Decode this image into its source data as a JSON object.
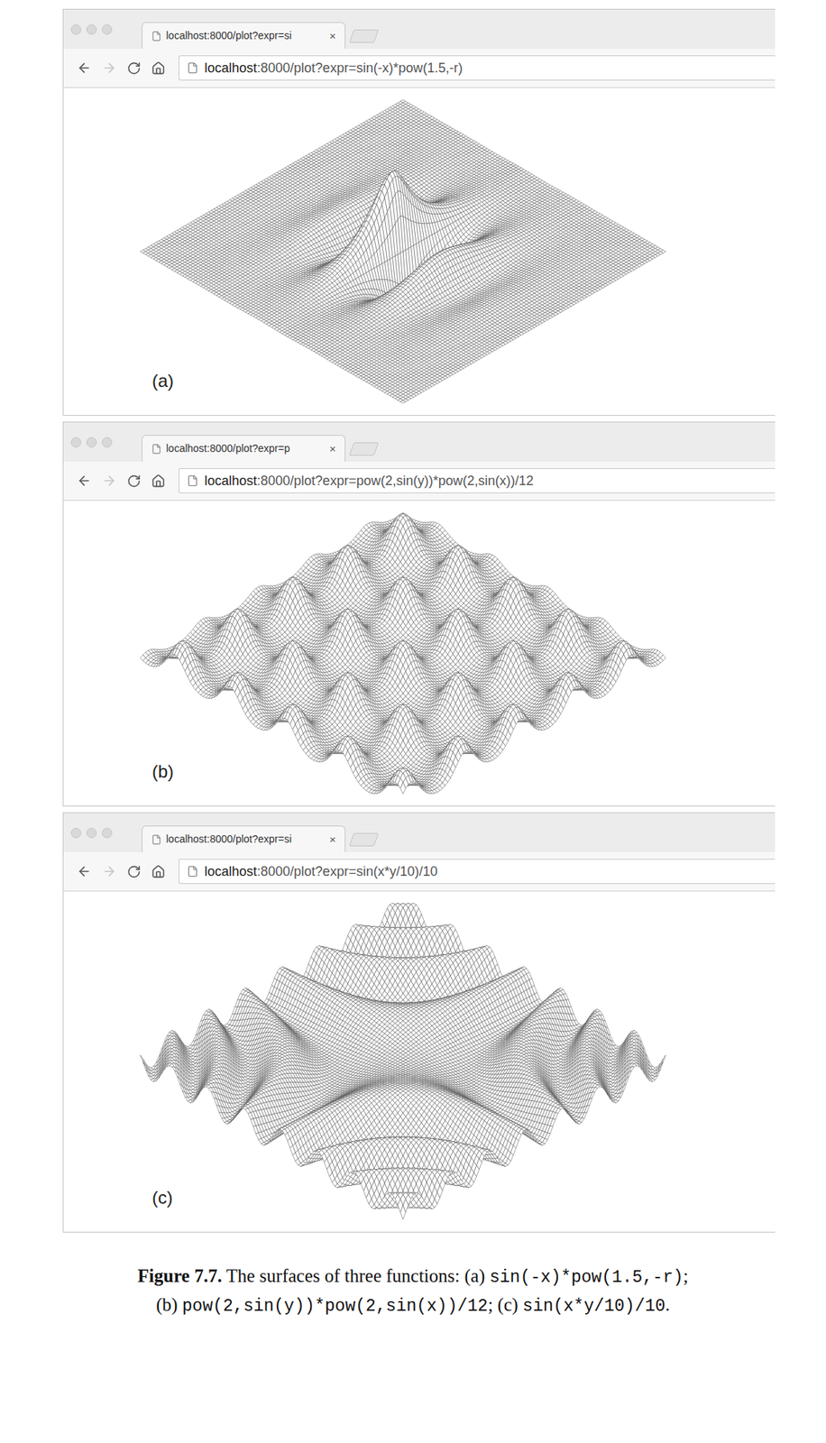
{
  "figures": [
    {
      "label": "(a)",
      "tab": {
        "title": "localhost:8000/plot?expr=si",
        "close": "×",
        "selected": true
      },
      "address": {
        "host": "localhost",
        "rest": ":8000/plot?expr=sin(-x)*pow(1.5,-r)"
      },
      "nav": {
        "back_disabled": false,
        "forward_disabled": true
      },
      "expr": "sin(-x)*pow(1.5,-r)"
    },
    {
      "label": "(b)",
      "tab": {
        "title": "localhost:8000/plot?expr=p",
        "close": "×",
        "selected": true
      },
      "address": {
        "host": "localhost",
        "rest": ":8000/plot?expr=pow(2,sin(y))*pow(2,sin(x))/12"
      },
      "nav": {
        "back_disabled": false,
        "forward_disabled": true
      },
      "expr": "pow(2,sin(y))*pow(2,sin(x))/12"
    },
    {
      "label": "(c)",
      "tab": {
        "title": "localhost:8000/plot?expr=si",
        "close": "×",
        "selected": true
      },
      "address": {
        "host": "localhost",
        "rest": ":8000/plot?expr=sin(x*y/10)/10"
      },
      "nav": {
        "back_disabled": false,
        "forward_disabled": true
      },
      "expr": "sin(x*y/10)/10"
    }
  ],
  "caption": {
    "lines": [
      [
        {
          "kind": "bold",
          "text": "Figure 7.7."
        },
        {
          "kind": "text",
          "text": " The surfaces of three functions: (a) "
        },
        {
          "kind": "code",
          "text": "sin(-x)*pow(1.5,-r)"
        },
        {
          "kind": "text",
          "text": ";"
        }
      ],
      [
        {
          "kind": "text",
          "text": "(b) "
        },
        {
          "kind": "code",
          "text": "pow(2,sin(y))*pow(2,sin(x))/12"
        },
        {
          "kind": "text",
          "text": "; (c) "
        },
        {
          "kind": "code",
          "text": "sin(x*y/10)/10"
        },
        {
          "kind": "text",
          "text": "."
        }
      ]
    ]
  }
}
